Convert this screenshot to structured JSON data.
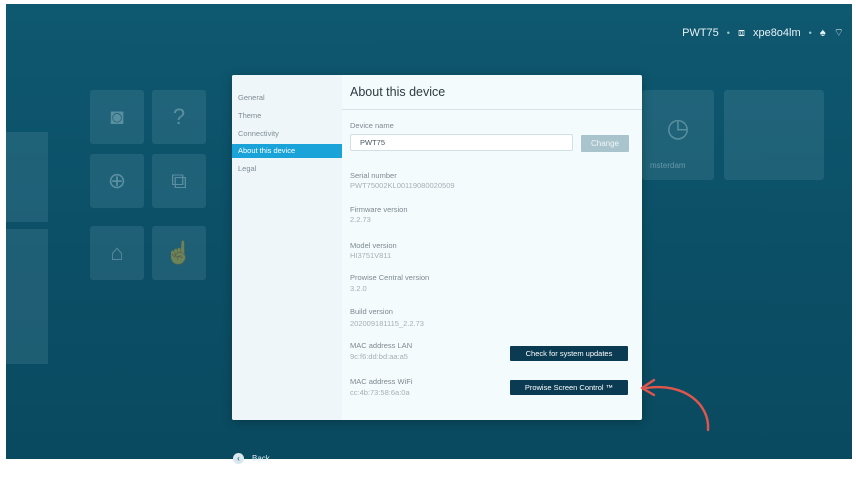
{
  "statusbar": {
    "device_name": "PWT75",
    "network_icon": "screen-cast-icon",
    "network_name": "xpe8o4lm",
    "bell_icon": "bell-icon",
    "wifi_icon": "wifi-icon"
  },
  "background": {
    "tile_icons": [
      "camera-icon",
      "question-icon",
      "globe-icon",
      "screen-share-icon",
      "education-icon",
      "touch-icon",
      "clock-icon"
    ],
    "clock_tile_label": "msterdam"
  },
  "dialog": {
    "nav": [
      {
        "label": "General",
        "active": false
      },
      {
        "label": "Theme",
        "active": false
      },
      {
        "label": "Connectivity",
        "active": false
      },
      {
        "label": "About this device",
        "active": true
      },
      {
        "label": "Legal",
        "active": false
      }
    ],
    "title": "About this device",
    "device_name": {
      "label": "Device name",
      "value": "PWT75",
      "button": "Change"
    },
    "fields": [
      {
        "label": "Serial number",
        "value": "PWT75002KL00119080020509"
      },
      {
        "label": "Firmware version",
        "value": "2.2.73"
      },
      {
        "label": "Model version",
        "value": "HI3751V811"
      },
      {
        "label": "Prowise Central version",
        "value": "3.2.0"
      },
      {
        "label": "Build version",
        "value": "202009181115_2.2.73"
      },
      {
        "label": "MAC address LAN",
        "value": "9c:f6:dd:bd:aa:a5"
      },
      {
        "label": "MAC address WiFi",
        "value": "cc:4b:73:58:6a:0a"
      }
    ],
    "check_updates_button": "Check for system updates",
    "screen_control_button": "Prowise Screen Control ™"
  },
  "back_label": "Back",
  "colors": {
    "accent": "#1aa3d9",
    "dark_button": "#0b3b52",
    "annotation_arrow": "#e0564d",
    "background": "#0b4f66"
  }
}
